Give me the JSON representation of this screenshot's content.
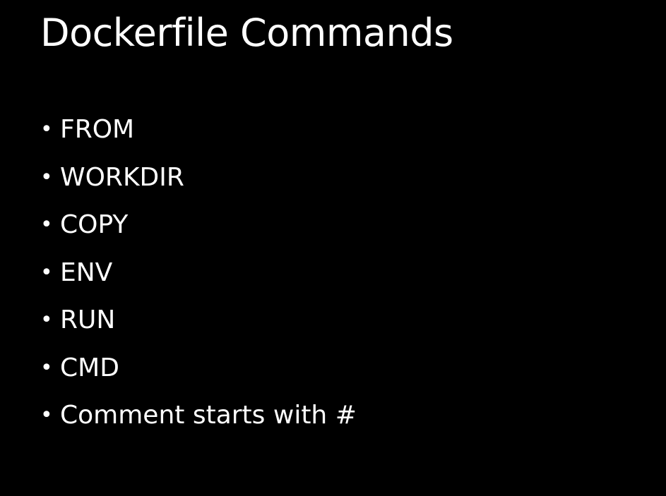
{
  "slide": {
    "title": "Dockerfile Commands",
    "bullet_glyph": "•",
    "items": [
      "FROM",
      "WORKDIR",
      "COPY",
      "ENV",
      "RUN",
      "CMD",
      "Comment starts with #"
    ],
    "colors": {
      "background": "#000000",
      "text": "#ffffff"
    }
  }
}
